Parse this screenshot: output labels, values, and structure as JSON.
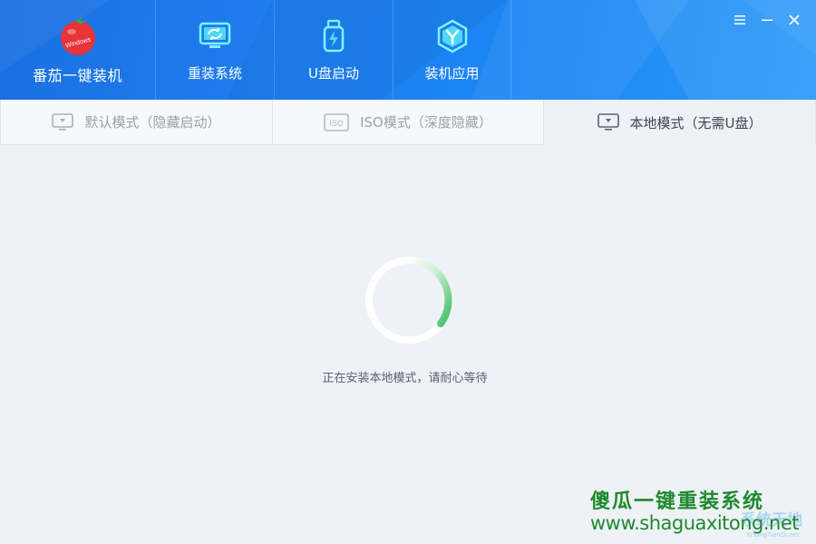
{
  "app": {
    "name": "番茄一键装机",
    "logo_text": "Windows"
  },
  "nav": [
    {
      "label": "重装系统",
      "icon": "monitor-refresh-icon"
    },
    {
      "label": "U盘启动",
      "icon": "usb-drive-icon"
    },
    {
      "label": "装机应用",
      "icon": "hexagon-app-icon"
    }
  ],
  "window_controls": [
    "menu-icon",
    "minimize-icon",
    "close-icon"
  ],
  "tabs": [
    {
      "label": "默认模式（隐藏启动）",
      "icon": "monitor-icon",
      "active": false
    },
    {
      "label": "ISO模式（深度隐藏）",
      "icon": "iso-icon",
      "icon_text": "ISO",
      "active": false
    },
    {
      "label": "本地模式（无需U盘）",
      "icon": "monitor-icon",
      "active": true
    }
  ],
  "status": {
    "text": "正在安装本地模式，请耐心等待"
  },
  "watermark": {
    "title": "傻瓜一键重装系统",
    "url": "www.shaguaxitong.net",
    "sub": "系统天地",
    "sub_small": "XiTongTianDi.net"
  },
  "colors": {
    "header_blue": "#1f7ef0",
    "spinner_green": "#3fbf63",
    "content_bg": "#eef1f6",
    "watermark_green": "#1e8a2e"
  }
}
